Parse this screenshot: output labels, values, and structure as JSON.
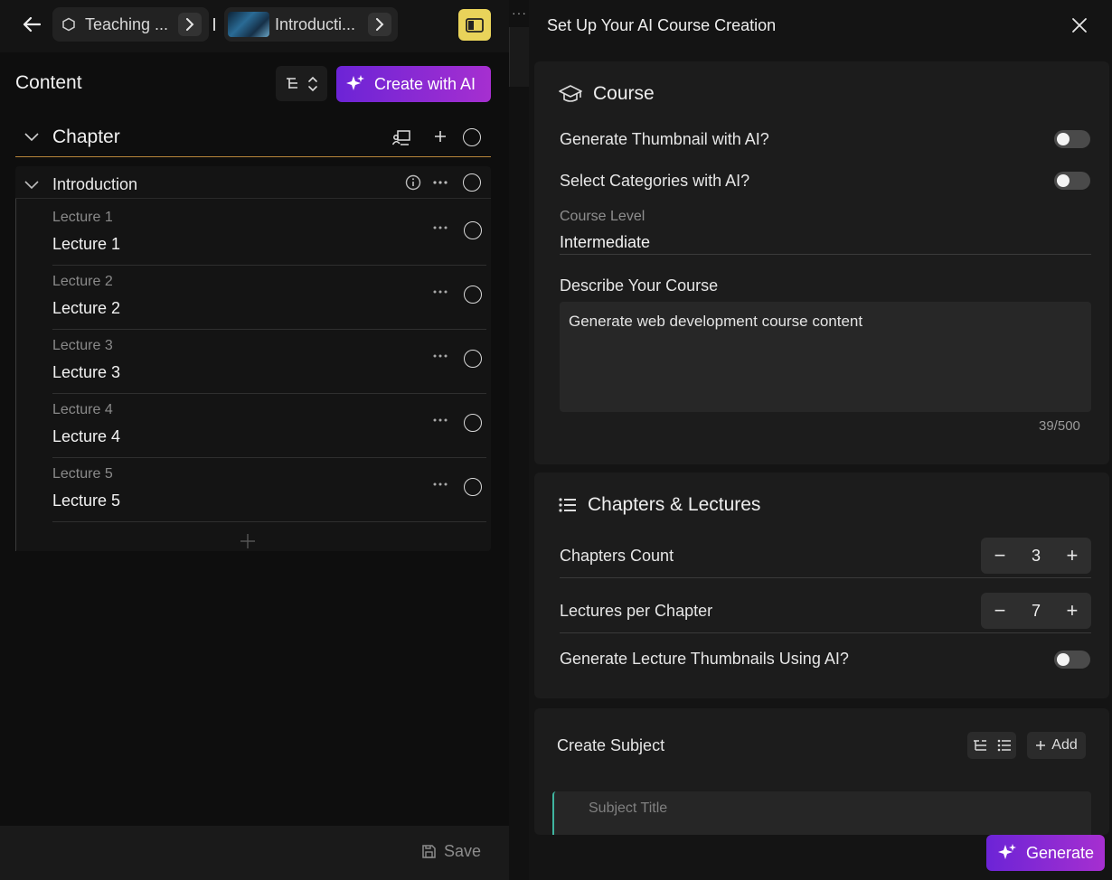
{
  "breadcrumb": {
    "crumb1": "Teaching ...",
    "crumb2": "Introducti..."
  },
  "left": {
    "title": "Content",
    "create_ai_label": "Create with AI",
    "chapter_label": "Chapter",
    "section_label": "Introduction",
    "lectures": [
      {
        "small": "Lecture 1",
        "main": "Lecture 1"
      },
      {
        "small": "Lecture 2",
        "main": "Lecture 2"
      },
      {
        "small": "Lecture 3",
        "main": "Lecture 3"
      },
      {
        "small": "Lecture 4",
        "main": "Lecture 4"
      },
      {
        "small": "Lecture 5",
        "main": "Lecture 5"
      }
    ],
    "save_label": "Save"
  },
  "right": {
    "title": "Set Up Your AI Course Creation",
    "course": {
      "heading": "Course",
      "thumb_ai_label": "Generate Thumbnail with AI?",
      "categories_ai_label": "Select Categories with AI?",
      "level_label": "Course Level",
      "level_value": "Intermediate",
      "describe_label": "Describe Your Course",
      "describe_value": "Generate web development course content",
      "counter": "39/500"
    },
    "chapters": {
      "heading": "Chapters & Lectures",
      "chapters_count_label": "Chapters Count",
      "chapters_count": "3",
      "lectures_label": "Lectures per Chapter",
      "lectures_count": "7",
      "lecture_thumb_label": "Generate Lecture Thumbnails Using AI?"
    },
    "subject": {
      "heading": "Create Subject",
      "add_label": "Add",
      "title_placeholder": "Subject Title"
    },
    "generate_label": "Generate"
  },
  "colors": {
    "accent_gradient_start": "#6c24d6",
    "accent_gradient_end": "#a62fd0",
    "panel_toggle": "#e9d35a",
    "chapter_underline": "#b7853a"
  }
}
